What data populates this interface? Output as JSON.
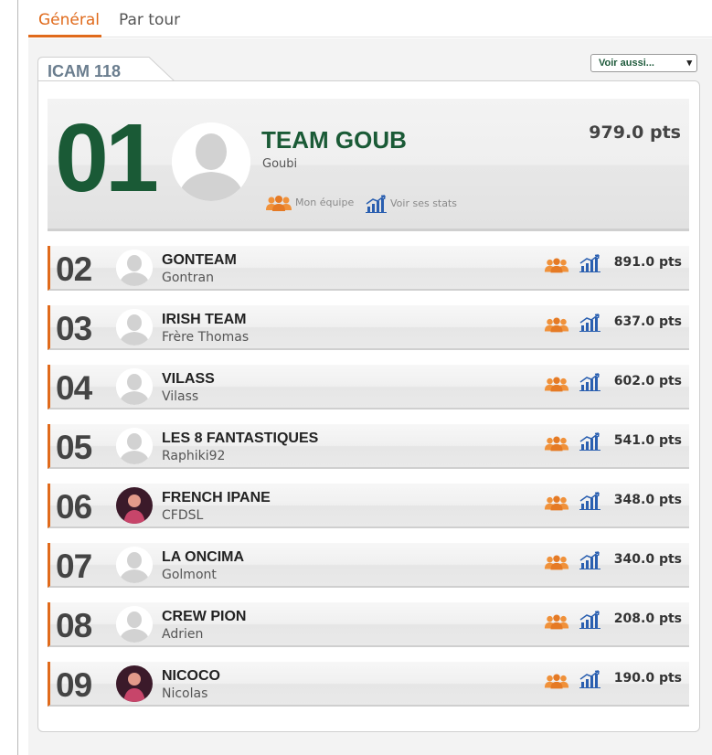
{
  "tabs": [
    {
      "label": "Général",
      "active": true
    },
    {
      "label": "Par tour",
      "active": false
    }
  ],
  "league": {
    "name": "ICAM 118"
  },
  "select": {
    "selected": "Voir aussi..."
  },
  "first": {
    "rank": "01",
    "team": "TEAM GOUB",
    "user": "Goubi",
    "points": "979.0 pts",
    "avatar": "default-avatar",
    "links": {
      "my_team": "Mon équipe",
      "stats": "Voir ses stats"
    }
  },
  "rows": [
    {
      "rank": "02",
      "team": "GONTEAM",
      "user": "Gontran",
      "points": "891.0 pts",
      "avatar": "default-avatar"
    },
    {
      "rank": "03",
      "team": "IRISH TEAM",
      "user": "Frère Thomas",
      "points": "637.0 pts",
      "avatar": "default-avatar"
    },
    {
      "rank": "04",
      "team": "VILASS",
      "user": "Vilass",
      "points": "602.0 pts",
      "avatar": "default-avatar"
    },
    {
      "rank": "05",
      "team": "LES 8 FANTASTIQUES",
      "user": "Raphiki92",
      "points": "541.0 pts",
      "avatar": "default-avatar"
    },
    {
      "rank": "06",
      "team": "FRENCH IPANE",
      "user": "CFDSL",
      "points": "348.0 pts",
      "avatar": "photo-avatar"
    },
    {
      "rank": "07",
      "team": "LA ONCIMA",
      "user": "Golmont",
      "points": "340.0 pts",
      "avatar": "default-avatar"
    },
    {
      "rank": "08",
      "team": "CREW PION",
      "user": "Adrien",
      "points": "208.0 pts",
      "avatar": "default-avatar"
    },
    {
      "rank": "09",
      "team": "NICOCO",
      "user": "Nicolas",
      "points": "190.0 pts",
      "avatar": "photo-avatar"
    }
  ],
  "colors": {
    "accent": "#e06a1b",
    "brand_green": "#1a5a36",
    "stats_blue": "#2a5fb0",
    "team_orange": "#f0913a"
  },
  "icons": {
    "team": "team-icon",
    "stats": "stats-chart-icon"
  }
}
